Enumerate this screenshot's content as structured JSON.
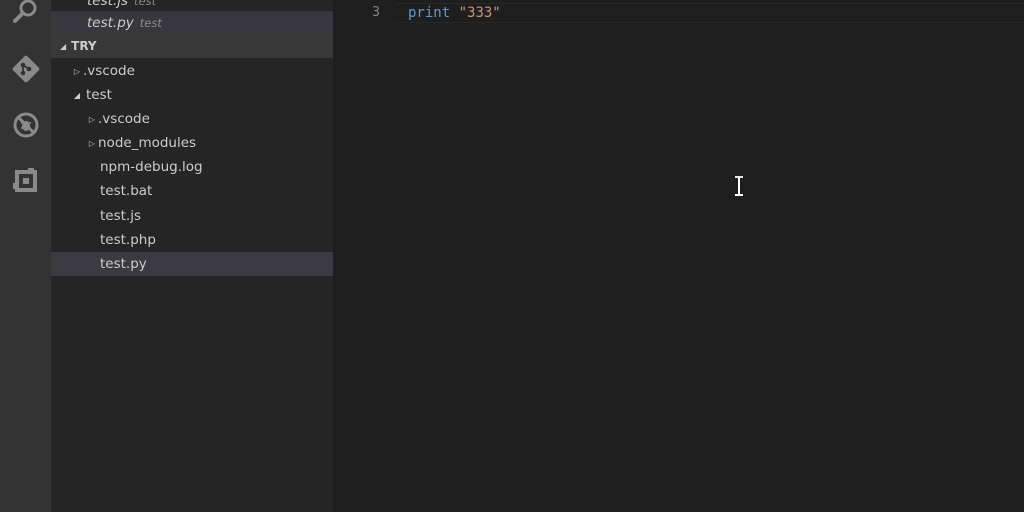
{
  "activity_bar": {
    "icons": [
      "search-icon",
      "git-icon",
      "debug-icon",
      "extensions-icon"
    ]
  },
  "open_editors": [
    {
      "name": "test.js",
      "desc": "test",
      "selected": false
    },
    {
      "name": "test.py",
      "desc": "test",
      "selected": true
    }
  ],
  "explorer": {
    "root_label": "TRY",
    "items": [
      {
        "label": ".vscode",
        "type": "folder",
        "expanded": false,
        "depth": 1
      },
      {
        "label": "test",
        "type": "folder",
        "expanded": true,
        "depth": 1
      },
      {
        "label": ".vscode",
        "type": "folder",
        "expanded": false,
        "depth": 2
      },
      {
        "label": "node_modules",
        "type": "folder",
        "expanded": false,
        "depth": 2
      },
      {
        "label": "npm-debug.log",
        "type": "file",
        "depth": 2
      },
      {
        "label": "test.bat",
        "type": "file",
        "depth": 2
      },
      {
        "label": "test.js",
        "type": "file",
        "depth": 2
      },
      {
        "label": "test.php",
        "type": "file",
        "depth": 2
      },
      {
        "label": "test.py",
        "type": "file",
        "depth": 2,
        "selected": true
      }
    ]
  },
  "editor": {
    "line_number": "3",
    "code": {
      "keyword": "print",
      "space": " ",
      "string": "\"333\""
    }
  },
  "colors": {
    "activity_bar": "#333333",
    "sidebar": "#252526",
    "editor": "#1e1e1e",
    "keyword": "#569cd6",
    "string": "#ce9178"
  }
}
